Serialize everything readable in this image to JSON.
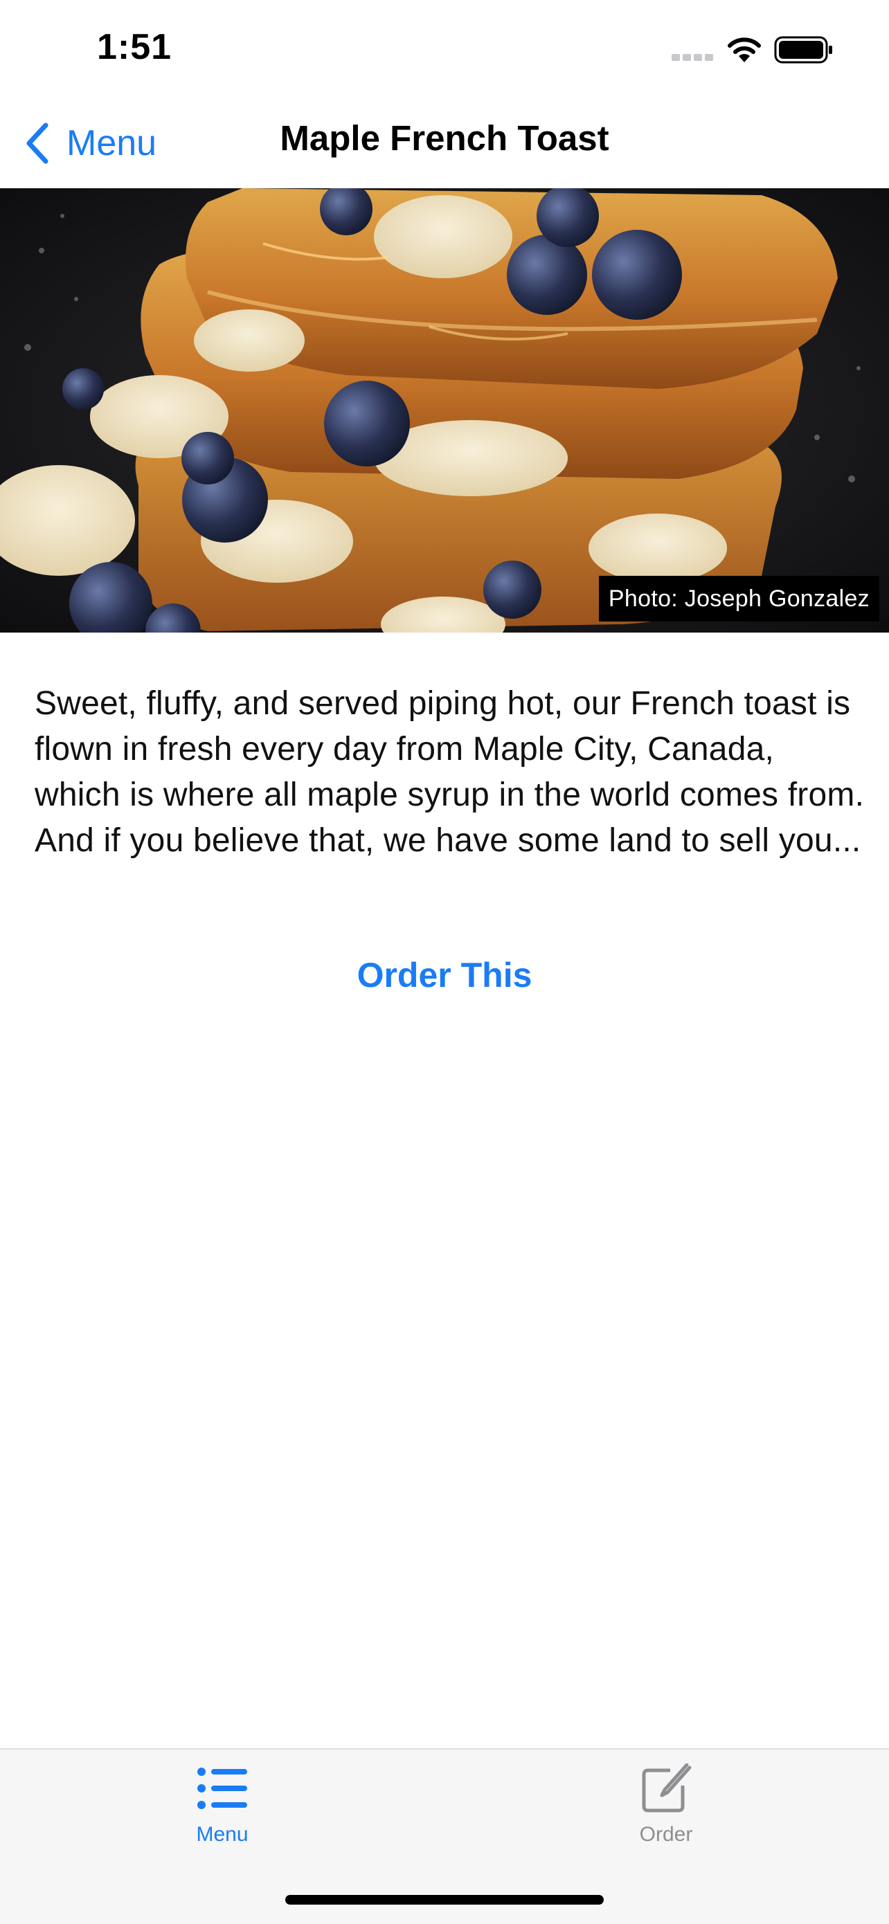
{
  "status_bar": {
    "time": "1:51",
    "icons": [
      "signal-icon",
      "wifi-icon",
      "battery-icon"
    ]
  },
  "nav": {
    "back_label": "Menu",
    "back_icon": "chevron-left-icon",
    "title": "Maple French Toast"
  },
  "hero": {
    "photo_credit": "Photo: Joseph Gonzalez"
  },
  "content": {
    "description": "Sweet, fluffy, and served piping hot, our French toast is flown in fresh every day from Maple City, Canada, which is where all maple syrup in the world comes from. And if you believe that, we have some land to sell you...",
    "order_button": "Order This"
  },
  "tab_bar": {
    "tabs": [
      {
        "label": "Menu",
        "icon": "list-icon",
        "selected": true
      },
      {
        "label": "Order",
        "icon": "compose-icon",
        "selected": false
      }
    ]
  },
  "colors": {
    "accent": "#1a7cf5",
    "inactive_tab": "#8e8e93",
    "tab_bar_bg": "#f6f6f6"
  }
}
